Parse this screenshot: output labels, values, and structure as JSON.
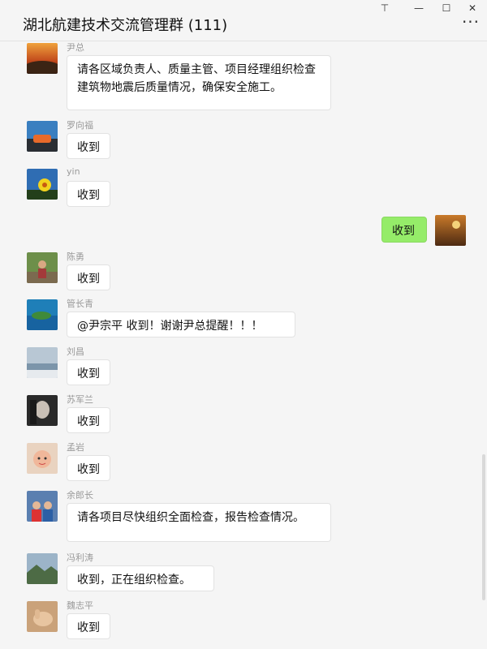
{
  "window": {
    "title": "湖北航建技术交流管理群 (111)",
    "controls": {
      "pin": "⊤",
      "minimize": "—",
      "maximize": "☐",
      "close": "✕"
    },
    "more": "···"
  },
  "messages": [
    {
      "sender": "尹总",
      "text": "请各区域负责人、质量主管、项目经理组织检查建筑物地震后质量情况，确保安全施工。",
      "avatar": "sunset-avatar"
    },
    {
      "sender": "罗向福",
      "text": "收到",
      "avatar": "car-avatar"
    },
    {
      "sender": "yin",
      "text": "收到",
      "avatar": "flower-avatar"
    },
    {
      "sender": "",
      "text": "收到",
      "avatar": "autumn-avatar",
      "self": true
    },
    {
      "sender": "陈勇",
      "text": "收到",
      "avatar": "person-outdoor-avatar"
    },
    {
      "sender": "管长青",
      "text": "@尹宗平 收到！谢谢尹总提醒！！！",
      "avatar": "island-avatar"
    },
    {
      "sender": "刘昌",
      "text": "收到",
      "avatar": "sea-avatar"
    },
    {
      "sender": "苏军兰",
      "text": "收到",
      "avatar": "portrait-avatar"
    },
    {
      "sender": "孟岩",
      "text": "收到",
      "avatar": "child-avatar"
    },
    {
      "sender": "余郎长",
      "text": "请各项目尽快组织全面检查，报告检查情况。",
      "avatar": "family-avatar"
    },
    {
      "sender": "冯利涛",
      "text": "收到，正在组织检查。",
      "avatar": "landscape-avatar"
    },
    {
      "sender": "魏志平",
      "text": "收到",
      "avatar": "hand-avatar"
    }
  ]
}
